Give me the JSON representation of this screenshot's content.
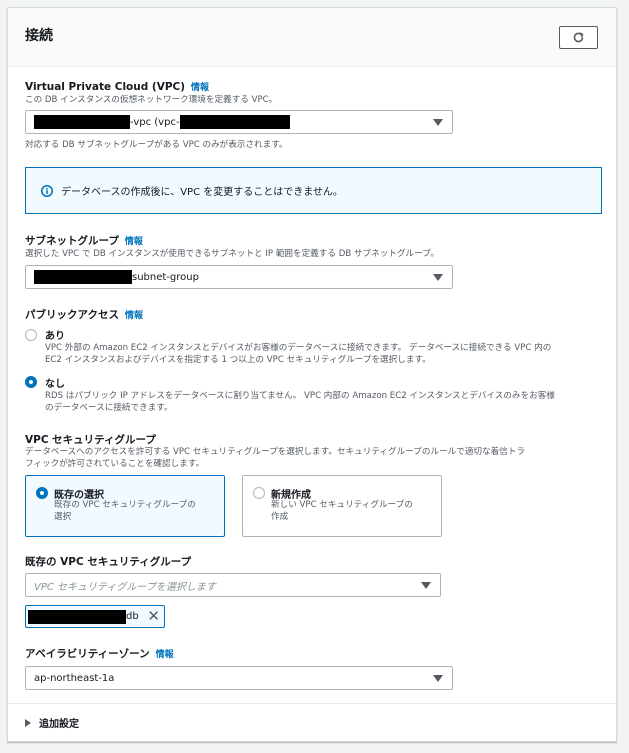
{
  "header": {
    "title": "接続"
  },
  "vpc": {
    "label": "Virtual Private Cloud (VPC)",
    "info": "情報",
    "description": "この DB インスタンスの仮想ネットワーク環境を定義する VPC。",
    "value_mid": "-vpc (vpc-",
    "hint": "対応する DB サブネットグループがある VPC のみが表示されます。"
  },
  "alert": {
    "text": "データベースの作成後に、VPC を変更することはできません。"
  },
  "subnet": {
    "label": "サブネットグループ",
    "info": "情報",
    "description": "選択した VPC で DB インスタンスが使用できるサブネットと IP 範囲を定義する DB サブネットグループ。",
    "value_suffix": "subnet-group"
  },
  "public_access": {
    "label": "パブリックアクセス",
    "info": "情報",
    "options": [
      {
        "label": "あり",
        "desc1": "VPC 外部の Amazon EC2 インスタンスとデバイスがお客様のデータベースに接続できます。 データベースに接続できる VPC 内の",
        "desc2": "EC2 インスタンスおよびデバイスを指定する 1 つ以上の VPC セキュリティグループを選択します。",
        "checked": false
      },
      {
        "label": "なし",
        "desc1": "RDS はパブリック IP アドレスをデータベースに割り当てません。 VPC 内部の Amazon EC2 インスタンスとデバイスのみをお客様",
        "desc2": "のデータベースに接続できます。",
        "checked": true
      }
    ]
  },
  "security_group": {
    "label": "VPC セキュリティグループ",
    "desc1": "データベースへのアクセスを許可する VPC セキュリティグループを選択します。セキュリティグループのルールで適切な着信トラ",
    "desc2": "フィックが許可されていることを確認します。",
    "tiles": [
      {
        "title": "既存の選択",
        "desc1": "既存の VPC セキュリティグループの",
        "desc2": "選択",
        "selected": true
      },
      {
        "title": "新規作成",
        "desc1": "新しい VPC セキュリティグループの",
        "desc2": "作成",
        "selected": false
      }
    ]
  },
  "existing_sg": {
    "label": "既存の VPC セキュリティグループ",
    "placeholder": "VPC セキュリティグループを選択します",
    "token_suffix": "db"
  },
  "az": {
    "label": "アベイラビリティーゾーン",
    "info": "情報",
    "value": "ap-northeast-1a"
  },
  "additional": {
    "label": "追加設定"
  },
  "colors": {
    "accent": "#0073bb",
    "border": "#aab7b8",
    "text_secondary": "#545b64"
  }
}
